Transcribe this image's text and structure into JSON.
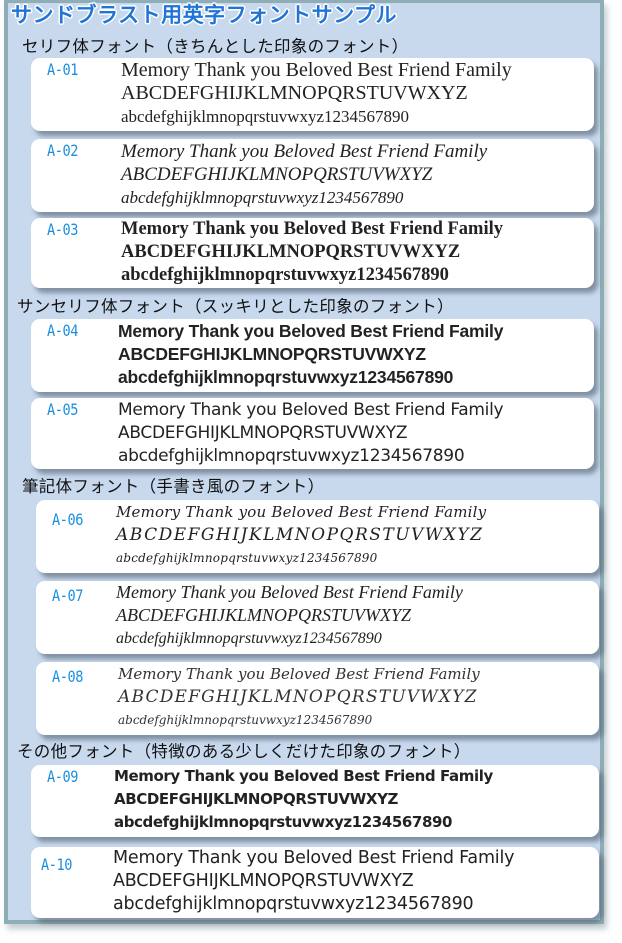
{
  "title": "サンドブラスト用英字フォントサンプル",
  "sections": [
    {
      "heading": "セリフ体フォント（きちんとした印象のフォント）"
    },
    {
      "heading": "サンセリフ体フォント（スッキリとした印象のフォント）"
    },
    {
      "heading": "筆記体フォント（手書き風のフォント）"
    },
    {
      "heading": "その他フォント（特徴のある少しくだけた印象のフォント）"
    }
  ],
  "samples": [
    {
      "code": "A-01",
      "lines": [
        "Memory   Thank you  Beloved Best Friend Family",
        "ABCDEFGHIJKLMNOPQRSTUVWXYZ",
        "abcdefghijklmnopqrstuvwxyz1234567890"
      ]
    },
    {
      "code": "A-02",
      "lines": [
        "Memory Thank you Beloved Best Friend  Family",
        "ABCDEFGHIJKLMNOPQRSTUVWXYZ",
        "abcdefghijklmnopqrstuvwxyz1234567890"
      ]
    },
    {
      "code": "A-03",
      "lines": [
        "Memory Thank you Beloved Best Friend Family",
        "ABCDEFGHIJKLMNOPQRSTUVWXYZ",
        "abcdefghijklmnopqrstuvwxyz1234567890"
      ]
    },
    {
      "code": "A-04",
      "lines": [
        "Memory Thank you Beloved Best Friend Family",
        "ABCDEFGHIJKLMNOPQRSTUVWXYZ",
        "abcdefghijklmnopqrstuvwxyz1234567890"
      ]
    },
    {
      "code": "A-05",
      "lines": [
        "Memory Thank you Beloved Best Friend Family",
        "ABCDEFGHIJKLMNOPQRSTUVWXYZ",
        "abcdefghijklmnopqrstuvwxyz1234567890"
      ]
    },
    {
      "code": "A-06",
      "lines": [
        "Memory Thank you Beloved Best Friend Family",
        "ABCDEFGHIJKLMNOPQRSTUVWXYZ",
        "abcdefghijklmnopqrstuvwxyz1234567890"
      ]
    },
    {
      "code": "A-07",
      "lines": [
        "Memory Thank you Beloved Best Friend Family",
        "ABCDEFGHIJKLMNOPQRSTUVWXYZ",
        "abcdefghijklmnopqrstuvwxyz1234567890"
      ]
    },
    {
      "code": "A-08",
      "lines": [
        "Memory Thank you Beloved Best Friend Family",
        "ABCDEFGHIJKLMNOPQRSTUVWXYZ",
        "abcdefghijklmnopqrstuvwxyz1234567890"
      ]
    },
    {
      "code": "A-09",
      "lines": [
        "Memory Thank you Beloved Best Friend Family",
        "ABCDEFGHIJKLMNOPQRSTUVWXYZ",
        "abcdefghijklmnopqrstuvwxyz1234567890"
      ]
    },
    {
      "code": "A-10",
      "lines": [
        "Memory Thank you Beloved Best Friend Family",
        "ABCDEFGHIJKLMNOPQRSTUVWXYZ",
        "abcdefghijklmnopqrstuvwxyz1234567890"
      ]
    }
  ],
  "colors": {
    "title": "#1f74d6",
    "code": "#1a8fe0",
    "panel": "#c8d9ee",
    "panel_border": "#8fadb6"
  }
}
